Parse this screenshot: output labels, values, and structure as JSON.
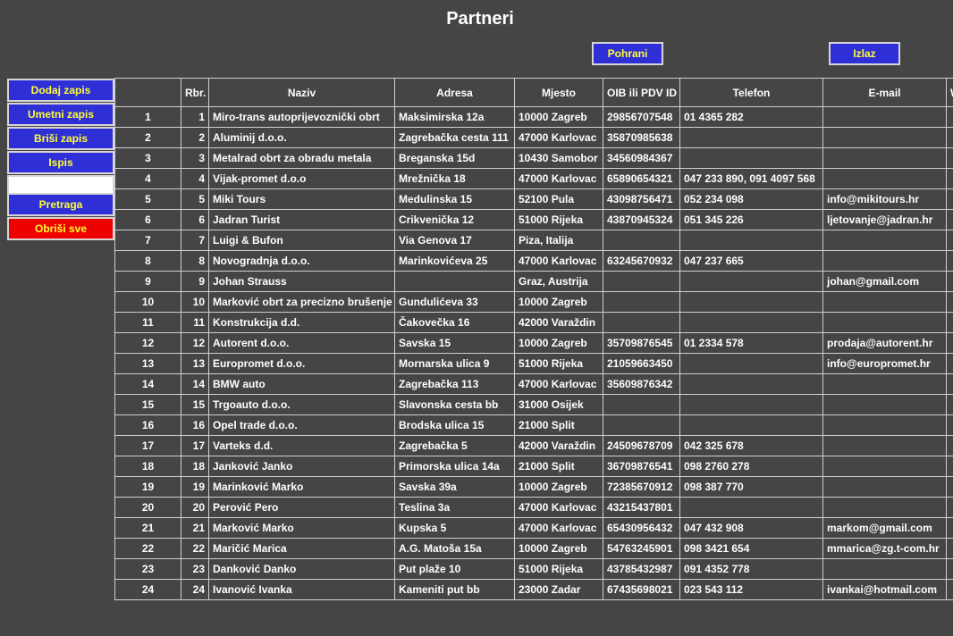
{
  "page": {
    "title": "Partneri"
  },
  "toolbar": {
    "save_label": "Pohrani",
    "exit_label": "Izlaz"
  },
  "sidebar": {
    "add": "Dodaj zapis",
    "insert": "Umetni zapis",
    "delete": "Briši zapis",
    "print": "Ispis",
    "search_value": "",
    "search": "Pretraga",
    "delete_all": "Obriši sve"
  },
  "colors": {
    "button_bg": "#2f2fd8",
    "button_text": "#ffff33",
    "danger_bg": "#ee0000",
    "page_bg": "#454545"
  },
  "table": {
    "columns": [
      "",
      "Rbr.",
      "Naziv",
      "Adresa",
      "Mjesto",
      "OIB ili PDV ID",
      "Telefon",
      "E-mail",
      "W"
    ],
    "rows": [
      [
        "1",
        "1",
        "Miro-trans autoprijevoznički obrt",
        "Maksimirska 12a",
        "10000 Zagreb",
        "29856707548",
        "01 4365 282",
        ""
      ],
      [
        "2",
        "2",
        "Aluminij d.o.o.",
        "Zagrebačka cesta 111",
        "47000 Karlovac",
        "35870985638",
        "",
        ""
      ],
      [
        "3",
        "3",
        "Metalrad obrt za obradu metala",
        "Breganska 15d",
        "10430 Samobor",
        "34560984367",
        "",
        ""
      ],
      [
        "4",
        "4",
        "Vijak-promet d.o.o",
        "Mrežnička 18",
        "47000 Karlovac",
        "65890654321",
        "047 233 890, 091 4097 568",
        ""
      ],
      [
        "5",
        "5",
        "Miki Tours",
        "Medulinska 15",
        "52100 Pula",
        "43098756471",
        "052 234 098",
        "info@mikitours.hr"
      ],
      [
        "6",
        "6",
        "Jadran Turist",
        "Crikvenička 12",
        "51000 Rijeka",
        "43870945324",
        "051 345 226",
        "ljetovanje@jadran.hr"
      ],
      [
        "7",
        "7",
        "Luigi & Bufon",
        "Via Genova 17",
        "Piza, Italija",
        "",
        "",
        ""
      ],
      [
        "8",
        "8",
        "Novogradnja d.o.o.",
        "Marinkovićeva 25",
        "47000 Karlovac",
        "63245670932",
        "047 237 665",
        ""
      ],
      [
        "9",
        "9",
        "Johan Strauss",
        "",
        "Graz, Austrija",
        "",
        "",
        "johan@gmail.com"
      ],
      [
        "10",
        "10",
        "Marković obrt za precizno brušenje",
        "Gundulićeva 33",
        "10000 Zagreb",
        "",
        "",
        ""
      ],
      [
        "11",
        "11",
        "Konstrukcija d.d.",
        "Čakovečka 16",
        "42000 Varaždin",
        "",
        "",
        ""
      ],
      [
        "12",
        "12",
        "Autorent d.o.o.",
        "Savska 15",
        "10000 Zagreb",
        "35709876545",
        "01 2334 578",
        "prodaja@autorent.hr"
      ],
      [
        "13",
        "13",
        "Europromet d.o.o.",
        "Mornarska ulica 9",
        "51000 Rijeka",
        "21059663450",
        "",
        "info@europromet.hr"
      ],
      [
        "14",
        "14",
        "BMW auto",
        "Zagrebačka 113",
        "47000 Karlovac",
        "35609876342",
        "",
        ""
      ],
      [
        "15",
        "15",
        "Trgoauto d.o.o.",
        "Slavonska cesta bb",
        "31000 Osijek",
        "",
        "",
        ""
      ],
      [
        "16",
        "16",
        "Opel trade d.o.o.",
        "Brodska ulica 15",
        "21000 Split",
        "",
        "",
        ""
      ],
      [
        "17",
        "17",
        "Varteks d.d.",
        "Zagrebačka 5",
        "42000 Varaždin",
        "24509678709",
        "042 325 678",
        ""
      ],
      [
        "18",
        "18",
        "Janković Janko",
        "Primorska ulica 14a",
        "21000 Split",
        "36709876541",
        "098 2760 278",
        ""
      ],
      [
        "19",
        "19",
        "Marinković Marko",
        "Savska 39a",
        "10000 Zagreb",
        "72385670912",
        "098 387 770",
        ""
      ],
      [
        "20",
        "20",
        "Perović Pero",
        "Teslina 3a",
        "47000 Karlovac",
        "43215437801",
        "",
        ""
      ],
      [
        "21",
        "21",
        "Marković Marko",
        "Kupska 5",
        "47000 Karlovac",
        "65430956432",
        "047 432 908",
        "markom@gmail.com"
      ],
      [
        "22",
        "22",
        "Maričić Marica",
        "A.G. Matoša 15a",
        "10000 Zagreb",
        "54763245901",
        "098 3421 654",
        "mmarica@zg.t-com.hr"
      ],
      [
        "23",
        "23",
        "Danković Danko",
        "Put plaže 10",
        "51000 Rijeka",
        "43785432987",
        "091 4352 778",
        ""
      ],
      [
        "24",
        "24",
        "Ivanović Ivanka",
        "Kameniti put bb",
        "23000 Zadar",
        "67435698021",
        "023 543 112",
        "ivankai@hotmail.com"
      ]
    ]
  }
}
